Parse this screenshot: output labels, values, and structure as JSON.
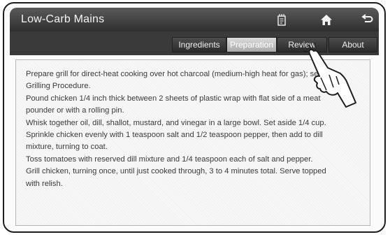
{
  "header": {
    "title": "Low-Carb Mains",
    "icons": [
      "recipe-card-icon",
      "home-icon",
      "back-icon"
    ]
  },
  "tabs": [
    {
      "label": "Ingredients",
      "active": false
    },
    {
      "label": "Preparation",
      "active": true
    },
    {
      "label": "Review",
      "active": false
    },
    {
      "label": "About",
      "active": false
    }
  ],
  "content": {
    "lines": [
      "Prepare grill for direct-heat cooking over hot charcoal (medium-high heat for gas); see",
      "Grilling Procedure.",
      "Pound chicken 1/4 inch thick between 2 sheets of plastic wrap with flat side of a meat",
      "pounder or with a rolling pin.",
      "Whisk together oil, dill, shallot, mustard, and vinegar in a large bowl. Set aside 1/4 cup.",
      "Sprinkle chicken evenly with 1 teaspoon salt and 1/2 teaspoon pepper, then add to dill",
      "mixture, turning to coat.",
      "Toss tomatoes with reserved dill mixture and 1/4 teaspoon each of salt and pepper.",
      "Grill chicken, turning once, until just cooked through, 3 to 4 minutes total. Serve topped",
      "with relish."
    ]
  }
}
